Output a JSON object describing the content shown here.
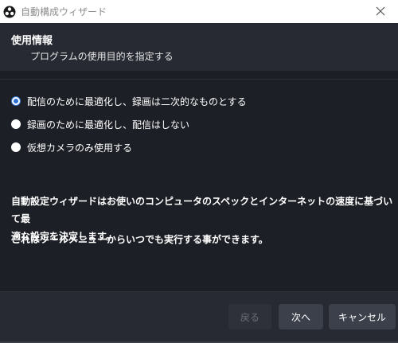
{
  "window": {
    "title": "自動構成ウィザード",
    "app_icon": "obs-logo-icon",
    "close_icon": "close-icon"
  },
  "header": {
    "title": "使用情報",
    "subtitle": "プログラムの使用目的を指定する"
  },
  "options": [
    {
      "label": "配信のために最適化し、録画は二次的なものとする",
      "checked": true
    },
    {
      "label": "録画のために最適化し、配信はしない",
      "checked": false
    },
    {
      "label": "仮想カメラのみ使用する",
      "checked": false
    }
  ],
  "description": {
    "line1": "自動設定ウィザードはお使いのコンピュータのスペックとインターネットの速度に基づいて最",
    "line2": "適な設定を決定します。",
    "line3": "これはツールメニューからいつでも実行する事ができます。"
  },
  "buttons": {
    "back": "戻る",
    "next": "次へ",
    "cancel": "キャンセル"
  },
  "colors": {
    "accent": "#2d6fd2",
    "background": "#1d1f26",
    "panel": "#272a33"
  }
}
